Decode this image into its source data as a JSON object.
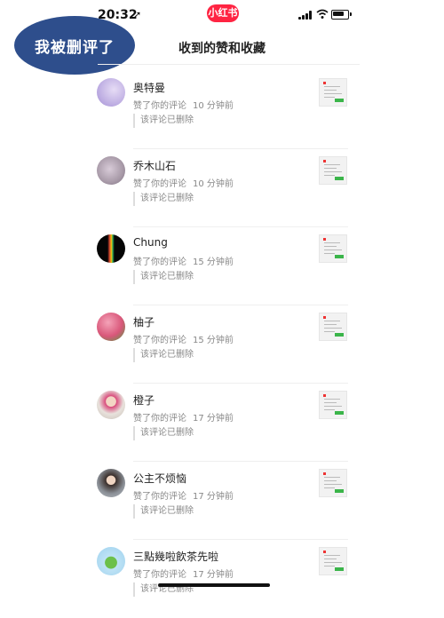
{
  "status_bar": {
    "time": "20:32"
  },
  "app_badge": "小红书",
  "overlay": {
    "text": "我被删评了",
    "color": "#2e4e8c"
  },
  "header": {
    "title": "收到的赞和收藏"
  },
  "notifications": [
    {
      "name": "奥特曼",
      "action": "赞了你的评论",
      "time": "10 分钟前",
      "deleted": "该评论已删除",
      "avatar_icon": "purple-avatar"
    },
    {
      "name": "乔木山石",
      "action": "赞了你的评论",
      "time": "10 分钟前",
      "deleted": "该评论已删除",
      "avatar_icon": "flower-avatar"
    },
    {
      "name": "Chung",
      "action": "赞了你的评论",
      "time": "15 分钟前",
      "deleted": "该评论已删除",
      "avatar_icon": "rainbow-avatar"
    },
    {
      "name": "柚子",
      "action": "赞了你的评论",
      "time": "15 分钟前",
      "deleted": "该评论已删除",
      "avatar_icon": "flowers-avatar"
    },
    {
      "name": "橙子",
      "action": "赞了你的评论",
      "time": "17 分钟前",
      "deleted": "该评论已删除",
      "avatar_icon": "person-avatar"
    },
    {
      "name": "公主不烦恼",
      "action": "赞了你的评论",
      "time": "17 分钟前",
      "deleted": "该评论已删除",
      "avatar_icon": "girl-avatar"
    },
    {
      "name": "三點幾啦飲茶先啦",
      "action": "赞了你的评论",
      "time": "17 分钟前",
      "deleted": "该评论已删除",
      "avatar_icon": "cartoon-avatar"
    }
  ]
}
